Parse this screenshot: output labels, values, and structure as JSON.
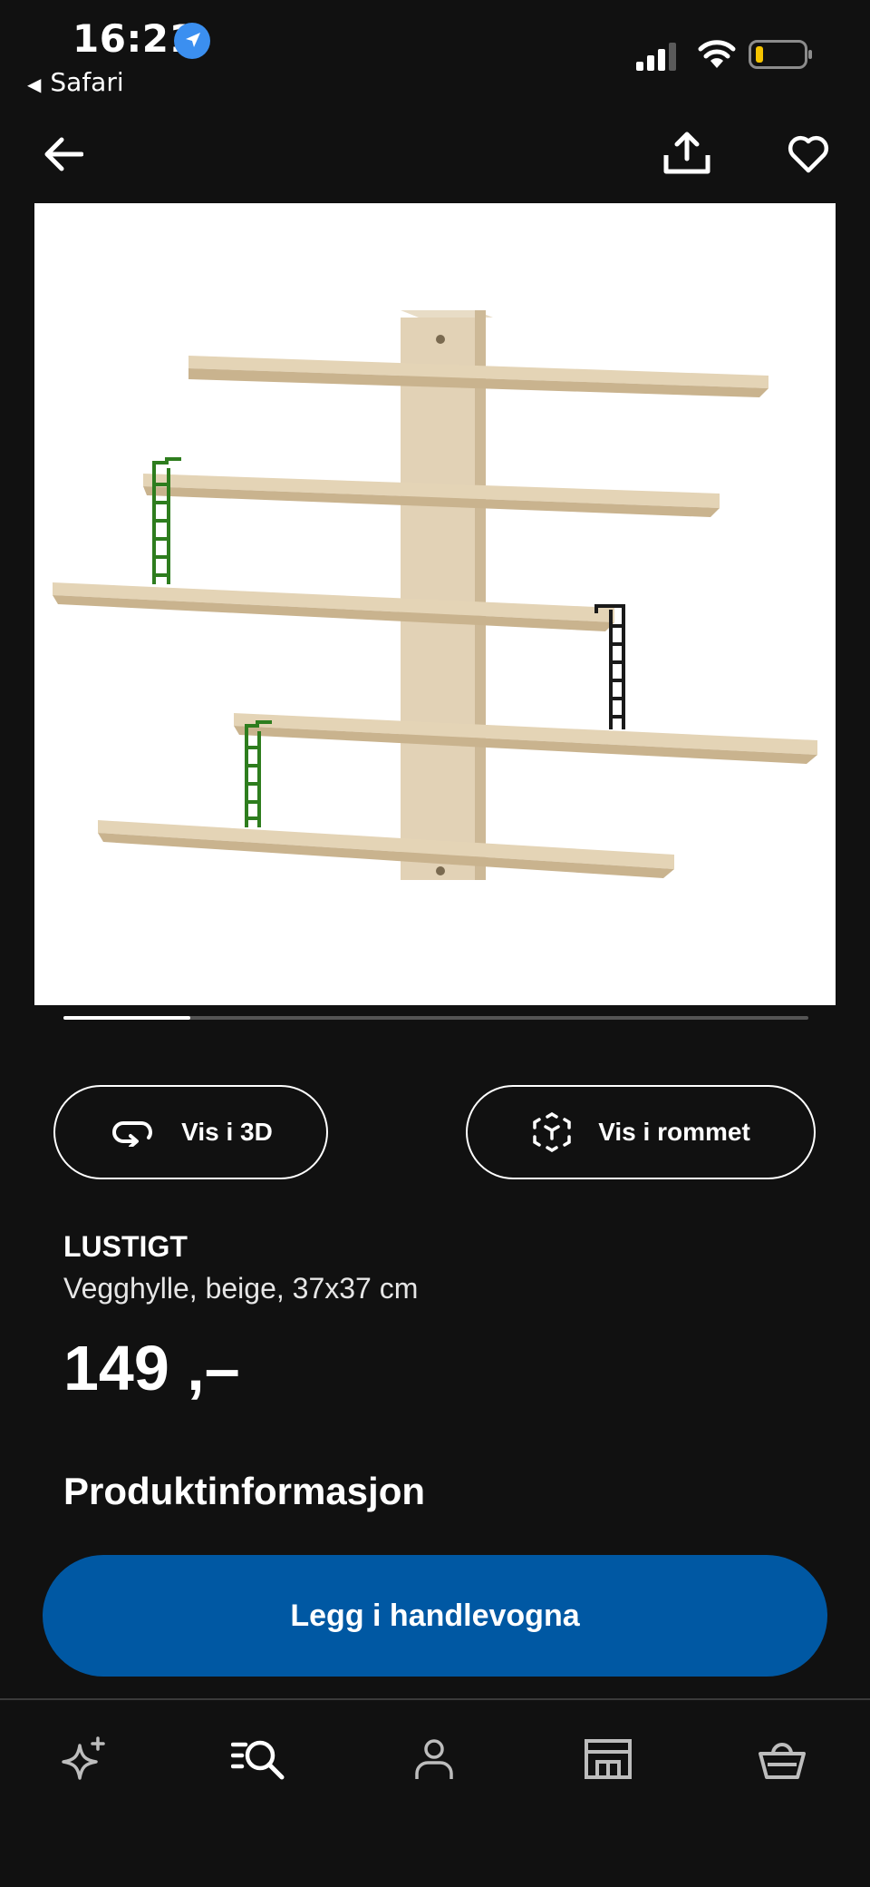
{
  "status_bar": {
    "time": "16:21",
    "back_app": "Safari",
    "icons": [
      "location-arrow-icon",
      "signal-icon",
      "wifi-icon",
      "battery-icon"
    ]
  },
  "nav": {
    "icons": [
      "arrow-left-icon",
      "share-icon",
      "heart-icon"
    ]
  },
  "gallery": {
    "image": "wall-shelf-product-photo",
    "progress": 0.17
  },
  "actions": {
    "view_3d_label": "Vis i 3D",
    "view_room_label": "Vis i rommet",
    "view_3d_icon": "rotate-360-icon",
    "view_room_icon": "ar-cube-icon"
  },
  "product": {
    "name": "LUSTIGT",
    "description": "Vegghylle, beige, 37x37 cm",
    "price": "149 ,–",
    "section_title": "Produktinformasjon"
  },
  "cart_button": {
    "label": "Legg i handlevogna",
    "color": "#0058A3"
  },
  "tab_bar": {
    "tabs": [
      "sparkle-icon",
      "search-list-icon",
      "profile-icon",
      "store-icon",
      "basket-icon"
    ]
  },
  "colors": {
    "background": "#111111",
    "accent_blue": "#0058A3",
    "location_badge": "#3B8FF0",
    "battery_level": "#F5C400"
  }
}
